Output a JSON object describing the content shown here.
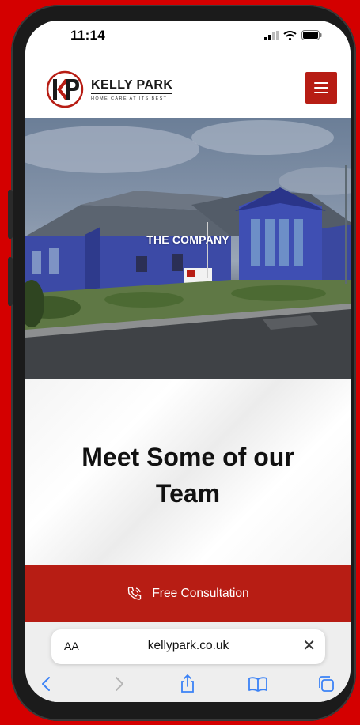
{
  "status_bar": {
    "time": "11:14"
  },
  "header": {
    "brand_name": "KELLY PARK",
    "brand_tagline": "HOME CARE AT ITS BEST",
    "logo_letters": "KP"
  },
  "hero": {
    "title": "THE COMPANY"
  },
  "team": {
    "heading": "Meet Some of our Team"
  },
  "cta": {
    "label": "Free Consultation"
  },
  "browser": {
    "text_size_label": "AA",
    "url": "kellypark.co.uk",
    "close_glyph": "✕"
  },
  "colors": {
    "brand_red": "#b71d14",
    "background_red": "#d40000",
    "building_blue": "#3c4aa6"
  }
}
